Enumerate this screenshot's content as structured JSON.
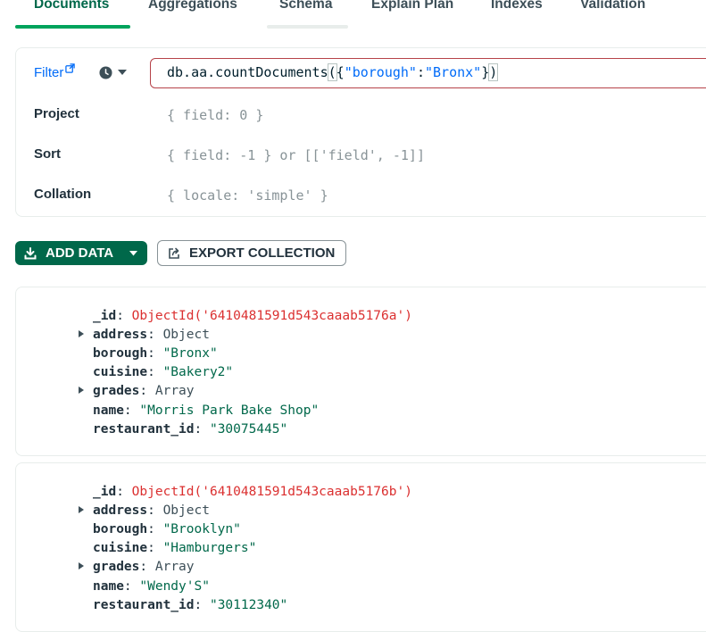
{
  "tabs": [
    "Documents",
    "Aggregations",
    "Schema",
    "Explain Plan",
    "Indexes",
    "Validation"
  ],
  "query": {
    "filter_label": "Filter",
    "filter_parts": {
      "prefix": "db.aa.countDocuments",
      "open": "(",
      "brace_open": "{",
      "key": "\"borough\"",
      "colon": ":",
      "value": "\"Bronx\"",
      "brace_close": "}",
      "close": ")"
    },
    "options": [
      {
        "label": "Project",
        "placeholder": "{ field: 0 }"
      },
      {
        "label": "Sort",
        "placeholder": "{ field: -1 } or [['field', -1]]"
      },
      {
        "label": "Collation",
        "placeholder": "{ locale: 'simple' }"
      }
    ]
  },
  "actions": {
    "add_data": "ADD DATA",
    "export": "EXPORT COLLECTION"
  },
  "documents": [
    {
      "id_value": "ObjectId('6410481591d543caaab5176a')",
      "fields": [
        {
          "key": "address",
          "value": "Object",
          "kind": "type",
          "expandable": true
        },
        {
          "key": "borough",
          "value": "\"Bronx\"",
          "kind": "string",
          "expandable": false
        },
        {
          "key": "cuisine",
          "value": "\"Bakery2\"",
          "kind": "string",
          "expandable": false
        },
        {
          "key": "grades",
          "value": "Array",
          "kind": "type",
          "expandable": true
        },
        {
          "key": "name",
          "value": "\"Morris Park Bake Shop\"",
          "kind": "string",
          "expandable": false
        },
        {
          "key": "restaurant_id",
          "value": "\"30075445\"",
          "kind": "string",
          "expandable": false
        }
      ]
    },
    {
      "id_value": "ObjectId('6410481591d543caaab5176b')",
      "fields": [
        {
          "key": "address",
          "value": "Object",
          "kind": "type",
          "expandable": true
        },
        {
          "key": "borough",
          "value": "\"Brooklyn\"",
          "kind": "string",
          "expandable": false
        },
        {
          "key": "cuisine",
          "value": "\"Hamburgers\"",
          "kind": "string",
          "expandable": false
        },
        {
          "key": "grades",
          "value": "Array",
          "kind": "type",
          "expandable": true
        },
        {
          "key": "name",
          "value": "\"Wendy'S\"",
          "kind": "string",
          "expandable": false
        },
        {
          "key": "restaurant_id",
          "value": "\"30112340\"",
          "kind": "string",
          "expandable": false
        }
      ]
    }
  ],
  "colors": {
    "accent_green": "#00684a",
    "active_tab_underline": "#00a35c",
    "link_blue": "#016bf8",
    "objectid_red": "#db3030",
    "filter_border_error": "#b64249"
  },
  "icons": {
    "filter_link": "external-link-icon",
    "history": "clock-icon",
    "add_data": "download-icon",
    "export": "export-icon"
  }
}
